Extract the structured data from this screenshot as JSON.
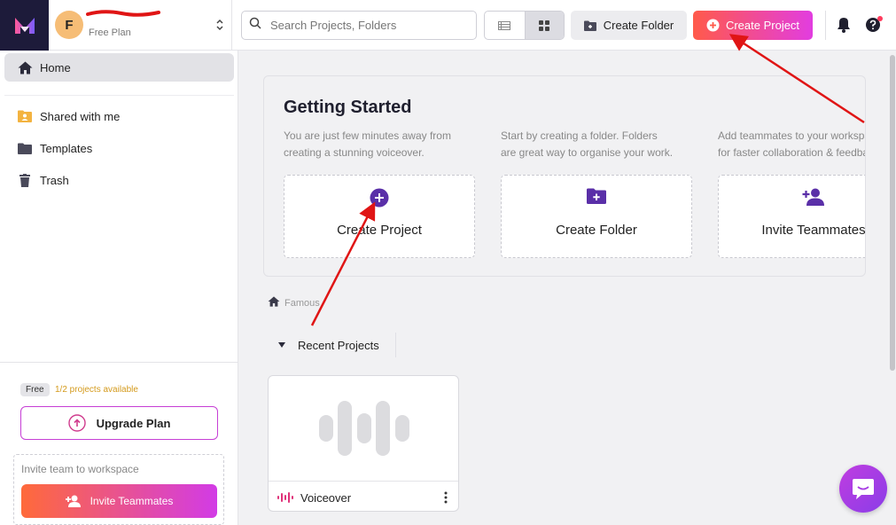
{
  "workspace": {
    "initial": "F",
    "plan": "Free Plan"
  },
  "topbar": {
    "search_placeholder": "Search Projects, Folders",
    "create_folder": "Create Folder",
    "create_project": "Create Project"
  },
  "sidebar": {
    "items": [
      {
        "label": "Home",
        "icon": "home-icon"
      },
      {
        "label": "Shared with me",
        "icon": "shared-folder-icon"
      },
      {
        "label": "Templates",
        "icon": "folder-icon"
      },
      {
        "label": "Trash",
        "icon": "trash-icon"
      }
    ],
    "plan_badge": "Free",
    "plan_status": "1/2 projects available",
    "upgrade_label": "Upgrade Plan",
    "invite_label": "Invite team to workspace",
    "invite_button": "Invite Teammates"
  },
  "getting_started": {
    "title": "Getting Started",
    "columns": [
      {
        "desc1": "You are just few minutes away from",
        "desc2": "creating a stunning voiceover.",
        "tile": "Create Project",
        "icon": "plus-circle-icon"
      },
      {
        "desc1": "Start by creating a folder. Folders",
        "desc2": "are great way to organise your work.",
        "tile": "Create Folder",
        "icon": "folder-plus-icon"
      },
      {
        "desc1": "Add teammates to your workspace",
        "desc2": "for faster collaboration & feedback",
        "tile": "Invite Teammates",
        "icon": "user-plus-icon"
      }
    ]
  },
  "breadcrumb": "Famous",
  "recent_tab": "Recent Projects",
  "projects": [
    {
      "name": "Voiceover"
    }
  ],
  "colors": {
    "accent_gradient_start": "#ff5a4a",
    "accent_gradient_end": "#e23de0",
    "sidebar_active": "#e2e2e6",
    "arrow": "#e01515"
  }
}
